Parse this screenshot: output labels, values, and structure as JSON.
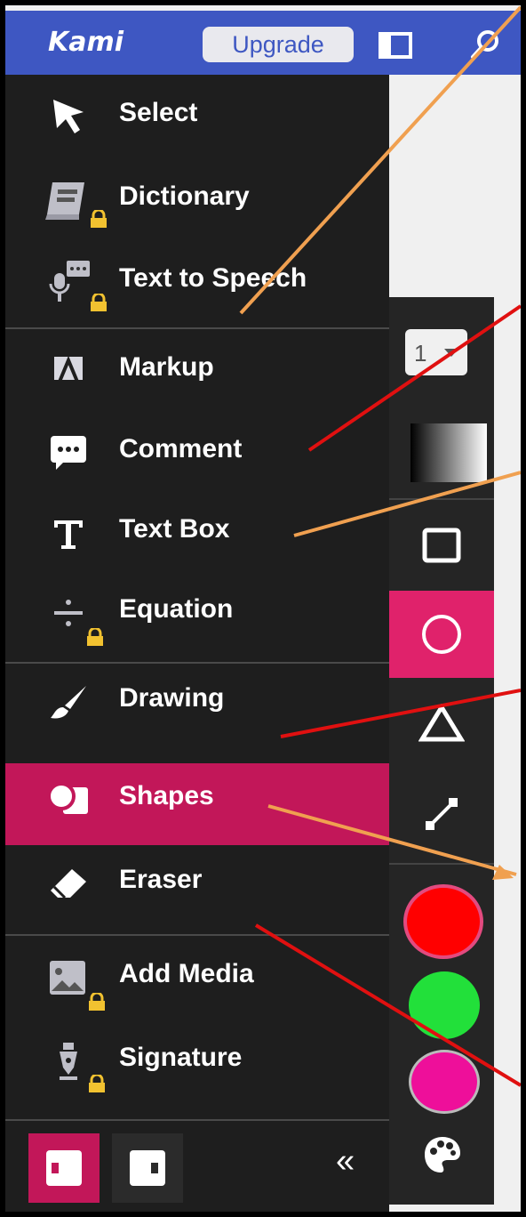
{
  "topbar": {
    "logo": "Kami",
    "upgrade_label": "Upgrade",
    "panel_icon": "panel-toggle-icon",
    "search_icon": "search-icon"
  },
  "sidebar": {
    "items": [
      {
        "label": "Select",
        "icon": "cursor-icon",
        "locked": false
      },
      {
        "label": "Dictionary",
        "icon": "book-icon",
        "locked": true
      },
      {
        "label": "Text to Speech",
        "icon": "microphone-speech-icon",
        "locked": true
      },
      {
        "label": "Markup",
        "icon": "markup-icon",
        "locked": false
      },
      {
        "label": "Comment",
        "icon": "comment-icon",
        "locked": false
      },
      {
        "label": "Text Box",
        "icon": "text-box-icon",
        "locked": false
      },
      {
        "label": "Equation",
        "icon": "divide-icon",
        "locked": true
      },
      {
        "label": "Drawing",
        "icon": "brush-icon",
        "locked": false
      },
      {
        "label": "Shapes",
        "icon": "shapes-icon",
        "locked": false,
        "active": true
      },
      {
        "label": "Eraser",
        "icon": "eraser-icon",
        "locked": false
      },
      {
        "label": "Add Media",
        "icon": "image-icon",
        "locked": true
      },
      {
        "label": "Signature",
        "icon": "pen-nib-icon",
        "locked": true
      }
    ],
    "collapse_label": "«"
  },
  "shape_toolbar": {
    "stroke_width_value": "1",
    "fill_icon": "gradient-fill-icon",
    "tools": [
      "rectangle-icon",
      "circle-icon",
      "triangle-icon",
      "line-icon"
    ],
    "active_tool": "circle-icon",
    "colors": [
      "#ff0000",
      "#22e03a",
      "#ee0f9a"
    ],
    "palette_icon": "palette-icon"
  },
  "colors": {
    "topbar": "#3e57c2",
    "sidebar": "#1e1e1e",
    "active": "#c21759",
    "active_tool": "#e0226b",
    "lock": "#f2c230",
    "arrow_orange": "#f0a050",
    "arrow_red": "#e01010"
  }
}
